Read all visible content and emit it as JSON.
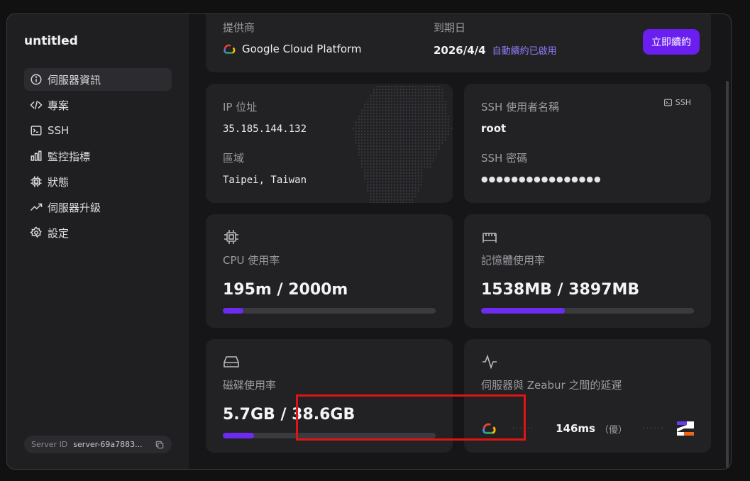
{
  "app": {
    "title": "untitled"
  },
  "sidebar": {
    "items": [
      {
        "label": "伺服器資訊",
        "icon": "info-icon",
        "active": true
      },
      {
        "label": "專案",
        "icon": "code-icon",
        "active": false
      },
      {
        "label": "SSH",
        "icon": "terminal-icon",
        "active": false
      },
      {
        "label": "監控指標",
        "icon": "bar-chart-icon",
        "active": false
      },
      {
        "label": "狀態",
        "icon": "chip-icon",
        "active": false
      },
      {
        "label": "伺服器升級",
        "icon": "trending-up-icon",
        "active": false
      },
      {
        "label": "設定",
        "icon": "gear-icon",
        "active": false
      }
    ],
    "server_id": {
      "label": "Server ID",
      "value": "server-69a7883..."
    }
  },
  "provider": {
    "label": "提供商",
    "value": "Google Cloud Platform",
    "expiry_label": "到期日",
    "expiry_date": "2026/4/4",
    "auto_renew": "自動續約已啟用",
    "renew_button": "立即續約"
  },
  "network": {
    "ip_label": "IP 位址",
    "ip_value": "35.185.144.132",
    "region_label": "區域",
    "region_value": "Taipei, Taiwan"
  },
  "ssh": {
    "user_label": "SSH 使用者名稱",
    "user_value": "root",
    "badge": "SSH",
    "password_label": "SSH 密碼",
    "password_mask": "●●●●●●●●●●●●●●●●"
  },
  "cpu": {
    "label": "CPU 使用率",
    "value": "195m / 2000m",
    "fraction": 0.0975
  },
  "memory": {
    "label": "記憶體使用率",
    "value": "1538MB / 3897MB",
    "fraction": 0.3947
  },
  "disk": {
    "label": "磁碟使用率",
    "value": "5.7GB / 38.6GB",
    "fraction": 0.1477
  },
  "latency": {
    "label": "伺服器與 Zeabur 之間的延遲",
    "value": "146ms",
    "quality": "（優）"
  },
  "colors": {
    "accent": "#6b1ef0",
    "highlight": "#e01414"
  }
}
